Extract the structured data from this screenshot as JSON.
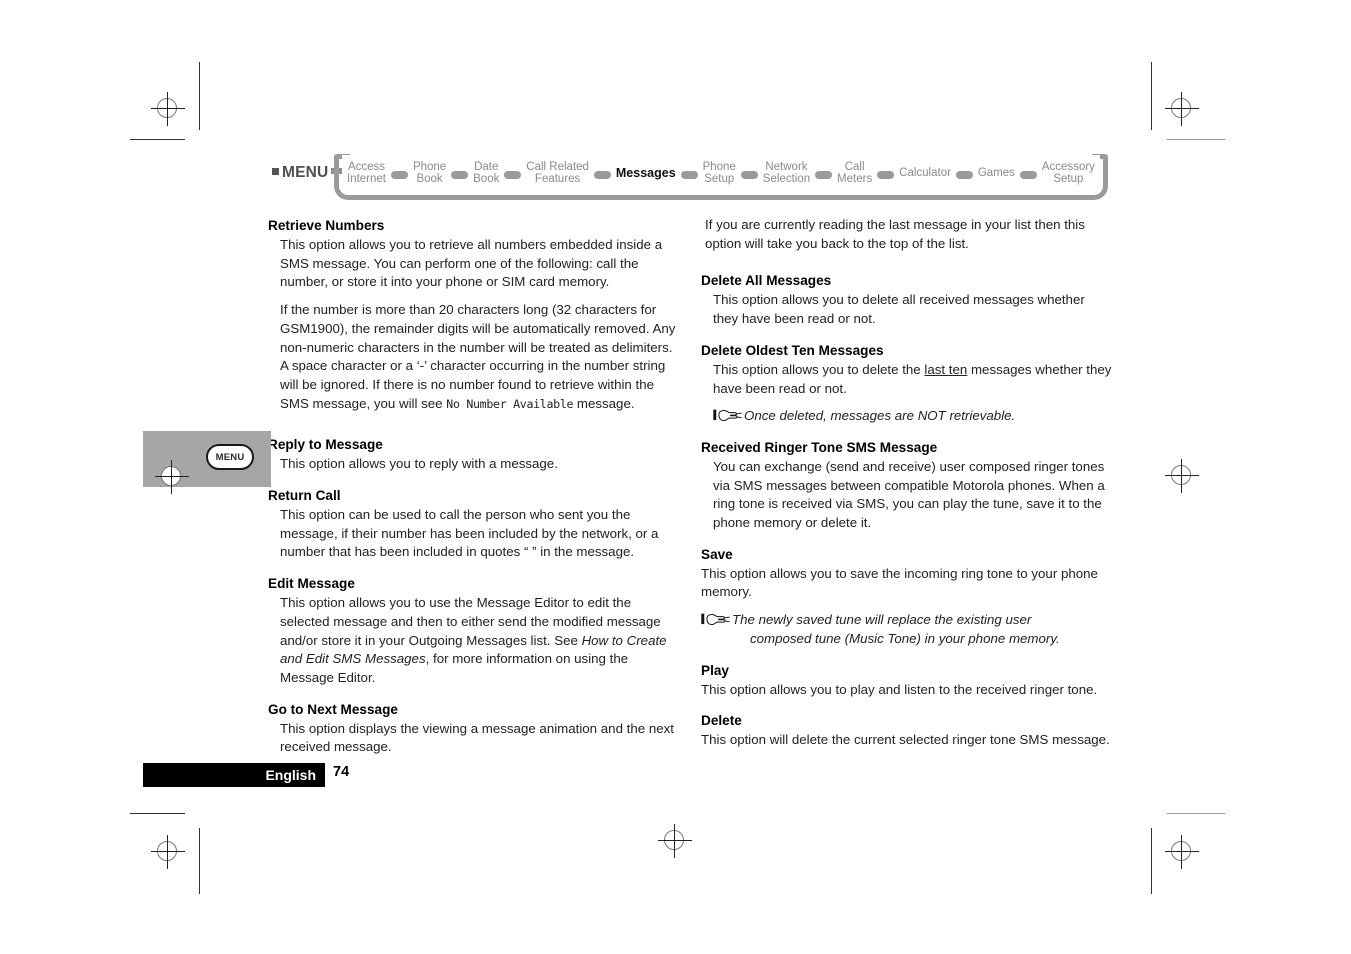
{
  "breadcrumb": {
    "menu_label": "MENU",
    "items": [
      {
        "label": "Access\nInternet",
        "current": false
      },
      {
        "label": "Phone\nBook",
        "current": false
      },
      {
        "label": "Date\nBook",
        "current": false
      },
      {
        "label": "Call Related\nFeatures",
        "current": false
      },
      {
        "label": "Messages",
        "current": true
      },
      {
        "label": "Phone\nSetup",
        "current": false
      },
      {
        "label": "Network\nSelection",
        "current": false
      },
      {
        "label": "Call\nMeters",
        "current": false
      },
      {
        "label": "Calculator",
        "current": false
      },
      {
        "label": "Games",
        "current": false
      },
      {
        "label": "Accessory\nSetup",
        "current": false
      }
    ]
  },
  "callout": {
    "key_label": "MENU"
  },
  "left_column": {
    "s1_heading": "Retrieve Numbers",
    "s1_p1": "This option allows you to retrieve all numbers embedded inside a SMS message. You can perform one of the following: call the number, or store it into your phone or SIM card memory.",
    "s1_p2_a": "If the number is more than 20 characters long (32 characters for GSM1900), the remainder digits will be automatically removed. Any non-numeric characters in the number will be treated as delimiters. A space character or a ‘-’ character occurring in the number string will be ignored. If there is no number found to retrieve within the SMS message, you will see ",
    "s1_p2_mono": "No Number Available",
    "s1_p2_b": " message.",
    "s2_heading": "Reply to Message",
    "s2_p1": "This option allows you to reply with a message.",
    "s3_heading": "Return Call",
    "s3_p1": "This option can be used to call the person who sent you the message, if their number has been included by the network, or a number that has been included in quotes “ ” in the message.",
    "s4_heading": "Edit Message",
    "s4_p1_a": "This option allows you to use the Message Editor to edit the selected message and then to either send the modified message and/or store it in your Outgoing Messages list. See ",
    "s4_p1_ital": "How to Create and Edit SMS Messages",
    "s4_p1_b": ", for more information on using the Message Editor.",
    "s5_heading": "Go to Next Message",
    "s5_p1": "This option displays the viewing a message animation and the next received message."
  },
  "right_column": {
    "r0_p1": "If you are currently reading the last message in your list then this option will take you back to the top of the list.",
    "r1_heading": "Delete All Messages",
    "r1_p1": "This option allows you to delete all received messages whether they have been read or not.",
    "r2_heading": "Delete Oldest Ten Messages",
    "r2_p1_a": "This option allows you to delete the ",
    "r2_p1_uline": "last ten",
    "r2_p1_b": " messages whether they have been read or not.",
    "r2_note": "Once deleted, messages are NOT retrievable.",
    "r3_heading": "Received Ringer Tone SMS Message",
    "r3_p1": "You can exchange (send and receive) user composed ringer tones via SMS messages between compatible Motorola phones. When a ring tone is received via SMS, you can play the tune, save it to the phone memory or delete it.",
    "r4_heading": "Save",
    "r4_p1": "This option allows you to save the incoming ring tone to your phone memory.",
    "r4_note_l1": "The newly saved tune will replace the existing user",
    "r4_note_l2": "composed tune (Music Tone) in your phone memory.",
    "r5_heading": "Play",
    "r5_p1": "This option allows you to play and listen to the received ringer tone.",
    "r6_heading": "Delete",
    "r6_p1": "This option will delete the current selected ringer tone SMS message."
  },
  "footer": {
    "language": "English",
    "page_number": "74"
  }
}
